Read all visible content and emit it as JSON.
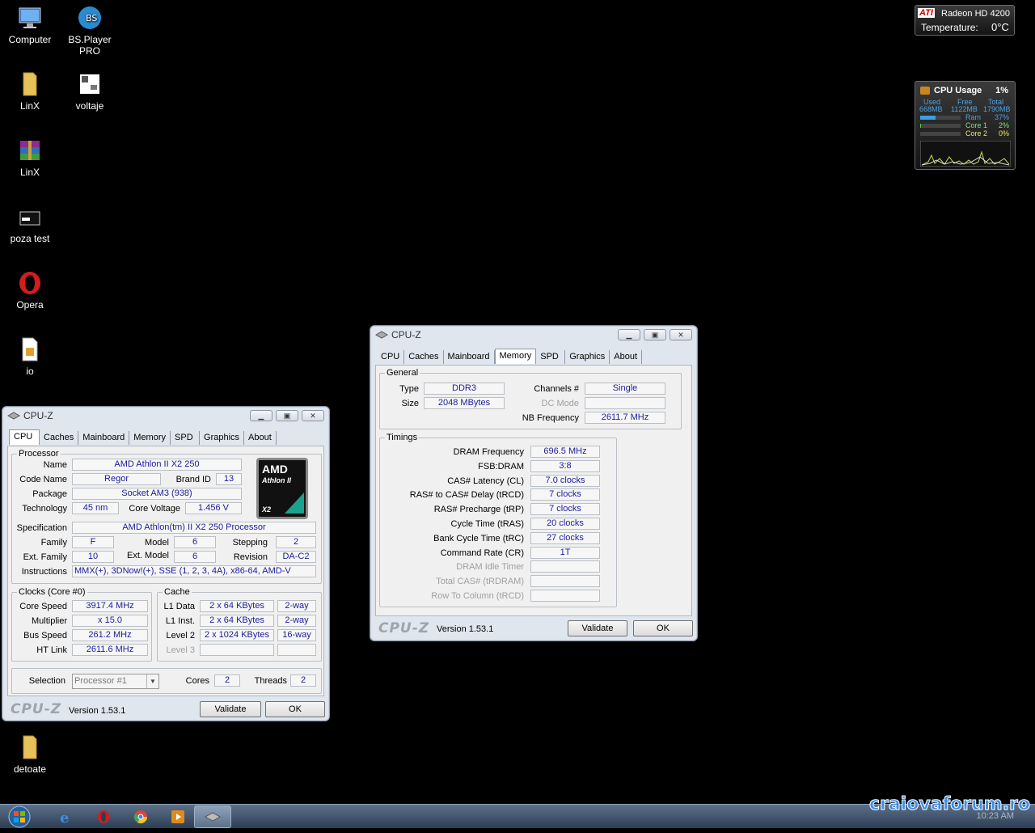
{
  "desktop": {
    "icons": [
      "Computer",
      "BS.Player PRO",
      "LinX",
      "voltaje",
      "LinX",
      "poza test",
      "Opera",
      "io",
      "detoate"
    ]
  },
  "gadget_gpu": {
    "brand": "ATI",
    "model": "Radeon HD 4200",
    "temp_label": "Temperature:",
    "temp_value": "0°C"
  },
  "gadget_cpu": {
    "title": "CPU Usage",
    "percent": "1%",
    "used_label": "Used",
    "free_label": "Free",
    "total_label": "Total",
    "used": "668MB",
    "free": "1122MB",
    "total": "1790MB",
    "ram_label": "Ram",
    "ram_pct": "37%",
    "core1_label": "Core 1",
    "core1_pct": "2%",
    "core2_label": "Core 2",
    "core2_pct": "0%",
    "ram_fill": 0.37,
    "core1_fill": 0.02,
    "core2_fill": 0.0
  },
  "cpuz_mem": {
    "title": "CPU-Z",
    "tabs": [
      "CPU",
      "Caches",
      "Mainboard",
      "Memory",
      "SPD",
      "Graphics",
      "About"
    ],
    "general_label": "General",
    "type_label": "Type",
    "type": "DDR3",
    "size_label": "Size",
    "size": "2048 MBytes",
    "channels_label": "Channels #",
    "channels": "Single",
    "dcmode_label": "DC Mode",
    "dcmode": "",
    "nbfreq_label": "NB Frequency",
    "nbfreq": "2611.7 MHz",
    "timings_label": "Timings",
    "timings": [
      {
        "label": "DRAM Frequency",
        "value": "696.5 MHz",
        "dis": false
      },
      {
        "label": "FSB:DRAM",
        "value": "3:8",
        "dis": false
      },
      {
        "label": "CAS# Latency (CL)",
        "value": "7.0 clocks",
        "dis": false
      },
      {
        "label": "RAS# to CAS# Delay (tRCD)",
        "value": "7 clocks",
        "dis": false
      },
      {
        "label": "RAS# Precharge (tRP)",
        "value": "7 clocks",
        "dis": false
      },
      {
        "label": "Cycle Time (tRAS)",
        "value": "20 clocks",
        "dis": false
      },
      {
        "label": "Bank Cycle Time (tRC)",
        "value": "27 clocks",
        "dis": false
      },
      {
        "label": "Command Rate (CR)",
        "value": "1T",
        "dis": false
      },
      {
        "label": "DRAM Idle Timer",
        "value": "",
        "dis": true
      },
      {
        "label": "Total CAS# (tRDRAM)",
        "value": "",
        "dis": true
      },
      {
        "label": "Row To Column (tRCD)",
        "value": "",
        "dis": true
      }
    ],
    "logo": "CPU-Z",
    "version": "Version 1.53.1",
    "validate": "Validate",
    "ok": "OK"
  },
  "cpuz_cpu": {
    "title": "CPU-Z",
    "tabs": [
      "CPU",
      "Caches",
      "Mainboard",
      "Memory",
      "SPD",
      "Graphics",
      "About"
    ],
    "processor_label": "Processor",
    "name_label": "Name",
    "name": "AMD Athlon II X2 250",
    "codename_label": "Code Name",
    "codename": "Regor",
    "brandid_label": "Brand ID",
    "brandid": "13",
    "package_label": "Package",
    "package": "Socket AM3 (938)",
    "tech_label": "Technology",
    "tech": "45 nm",
    "voltage_label": "Core Voltage",
    "voltage": "1.456 V",
    "spec_label": "Specification",
    "spec": "AMD Athlon(tm) II X2 250 Processor",
    "family_label": "Family",
    "family": "F",
    "model_label": "Model",
    "model": "6",
    "stepping_label": "Stepping",
    "stepping": "2",
    "extfamily_label": "Ext. Family",
    "extfamily": "10",
    "extmodel_label": "Ext. Model",
    "extmodel": "6",
    "revision_label": "Revision",
    "revision": "DA-C2",
    "instr_label": "Instructions",
    "instr": "MMX(+), 3DNow!(+), SSE (1, 2, 3, 4A), x86-64, AMD-V",
    "logo_amd": "AMD",
    "logo_line": "Athlon II",
    "logo_x2": "X2",
    "clocks_label": "Clocks (Core #0)",
    "corespeed_label": "Core Speed",
    "corespeed": "3917.4 MHz",
    "mult_label": "Multiplier",
    "mult": "x 15.0",
    "bus_label": "Bus Speed",
    "bus": "261.2 MHz",
    "ht_label": "HT Link",
    "ht": "2611.6 MHz",
    "cache_label": "Cache",
    "l1d_label": "L1 Data",
    "l1d": "2 x 64 KBytes",
    "l1d_way": "2-way",
    "l1i_label": "L1 Inst.",
    "l1i": "2 x 64 KBytes",
    "l1i_way": "2-way",
    "l2_label": "Level 2",
    "l2": "2 x 1024 KBytes",
    "l2_way": "16-way",
    "l3_label": "Level 3",
    "selection_label": "Selection",
    "selection": "Processor #1",
    "cores_label": "Cores",
    "cores": "2",
    "threads_label": "Threads",
    "threads": "2",
    "logo": "CPU-Z",
    "version": "Version 1.53.1",
    "validate": "Validate",
    "ok": "OK"
  },
  "taskbar": {
    "clock": "10:23 AM",
    "watermark": "craiovaforum.ro"
  }
}
